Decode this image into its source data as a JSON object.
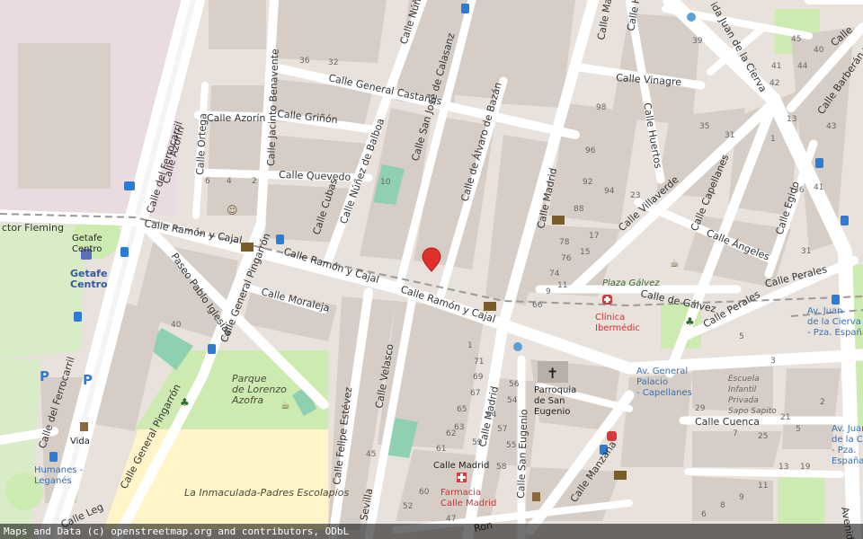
{
  "colors": {
    "land": "#e9e2dc",
    "building": "#d6cec6",
    "road": "#ffffff",
    "park": "#cdebb0",
    "pitch": "#8fd0b0",
    "school": "#fff5c8",
    "pink": "#eadbe0",
    "rail": "#9a9a9a",
    "marker": "#e0302a",
    "transit": "#2d7bd3",
    "health": "#d63a3a"
  },
  "streets": {
    "ramon_y_cajal_1": "Calle Ramón y Cajal",
    "ramon_y_cajal_2": "Calle Ramón y Cajal",
    "ramon_y_cajal_3": "Calle Ramón y Cajal",
    "general_castanos": "Calle General Castaños",
    "grinon": "Calle Griñón",
    "quevedo": "Calle Quevedo",
    "azorin_h": "Calle Azorín",
    "azorin_v": "Calle Azorín",
    "jacinto_benavente": "Calle Jacinto Benavente",
    "ortega": "Calle Ortega",
    "cubas": "Calle Cubas",
    "nunez_balboa": "Calle Núñez de Balboa",
    "nunez_top": "Calle Núñe",
    "san_jose_calasanz": "Calle San José de Calasanz",
    "alvaro_bazan": "Calle de Álvaro de Bazán",
    "madrid_upper": "Calle Madrid",
    "madrid_lower": "Calle Madrid",
    "vinagre": "Calle Vinagre",
    "huertos_1": "Calle Huertos",
    "huertos_2": "Calle Huertos",
    "villaverde": "Calle Villaverde",
    "capellanes_1": "Calle Capellanes",
    "capellanes_2": "Calle Perales",
    "angeles": "Calle Ángeles",
    "egido": "Calle Egido",
    "perales": "Calle Perales",
    "galvez": "Calle de Gálvez",
    "juan_cierva": "Avenida Juan de la Cierva",
    "barberan": "Calle Barberán y",
    "ferrocarril_1": "Calle del Ferrocarril",
    "ferrocarril_2": "Calle del Ferrocarril",
    "pablo_iglesias": "Paseo Pablo Iglesias",
    "general_pingarron_1": "Calle General Pingarrón",
    "general_pingarron_2": "Calle General Pingarrón",
    "moraleja": "Calle Moraleja",
    "felipe_estevez": "Calle Felipe Estévez",
    "velasco": "Calle Velasco",
    "sevilla": "Sevilla",
    "san_eugenio": "Calle San Eugenio",
    "manzana": "Calle Manzana",
    "cuenca": "Calle Cuenca",
    "fleming": "ctor Fleming",
    "leganes_bottom": "Calle Leg",
    "ron_bottom": "Ron",
    "avenida_right": "Avenida",
    "madrid_top": "Calle Ma",
    "juan_top": "ida Juan de la Cierva",
    "calle_top_right": "Calle"
  },
  "places": {
    "getafe_centro_small": "Getafe Centro",
    "getafe_centro_station": "Getafe Centro",
    "humanes_leganes": "Humanes - Leganés",
    "vida": "Vida",
    "parque_azofra": "Parque de Lorenzo Azofra",
    "inmaculada": "La Inmaculada-Padres Escolapios",
    "parroquia": "Parroquia de San Eugenio",
    "calle_madrid_stop": "Calle Madrid",
    "farmacia": "Farmacia Calle Madrid",
    "clinica": "Clínica Ibermédic",
    "plaza_galvez": "Plaza Gálvez",
    "av_general_palacio": "Av. General Palacio - Capellanes",
    "escuela": "Escuela Infantil Privada Sapo Sapito",
    "av_juan_cierva_espana": "Av. Juan de la Cierva - Pza. España",
    "av_juan_cierva_espana_2": "Av. Juan de la Cierva - Pza. España"
  },
  "house_numbers": [
    "36",
    "32",
    "6",
    "4",
    "2",
    "10",
    "98",
    "96",
    "92",
    "94",
    "88",
    "78",
    "76",
    "74",
    "66",
    "17",
    "15",
    "11",
    "9",
    "23",
    "35",
    "31",
    "45",
    "40",
    "39",
    "41",
    "44",
    "1",
    "71",
    "69",
    "67",
    "65",
    "63",
    "61",
    "59",
    "57",
    "55",
    "58",
    "56",
    "54",
    "64",
    "62",
    "60",
    "52",
    "47",
    "45",
    "40",
    "2",
    "5",
    "29",
    "7",
    "25",
    "21",
    "19",
    "13",
    "11",
    "9",
    "8",
    "6",
    "5",
    "3",
    "1",
    "36",
    "41",
    "31",
    "43",
    "13",
    "42"
  ],
  "attribution": "Maps and Data (c) openstreetmap.org and contributors, ODbL"
}
